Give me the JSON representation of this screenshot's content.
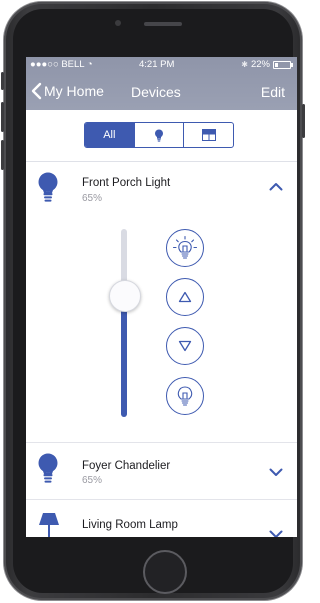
{
  "status_bar": {
    "carrier": "●●●○○ BELL ◔",
    "time": "4:21 PM",
    "bluetooth": "✱",
    "battery_percent": "22%",
    "battery_level": 0.22
  },
  "nav": {
    "back_label": "My Home",
    "title": "Devices",
    "edit_label": "Edit"
  },
  "filter": {
    "options": [
      {
        "label": "All",
        "icon": "",
        "selected": true
      },
      {
        "label": "",
        "icon": "bulb-icon",
        "selected": false
      },
      {
        "label": "",
        "icon": "window-blind-icon",
        "selected": false
      }
    ]
  },
  "devices": [
    {
      "name": "Front Porch Light",
      "level": "65%",
      "level_value": 0.65,
      "expanded": true,
      "icon": "bulb-icon"
    },
    {
      "name": "Foyer Chandelier",
      "level": "65%",
      "level_value": 0.65,
      "expanded": false,
      "icon": "bulb-icon"
    },
    {
      "name": "Living Room Lamp",
      "level": "",
      "expanded": false,
      "icon": "lamp-icon"
    }
  ],
  "controls": [
    {
      "icon": "light-on-icon"
    },
    {
      "icon": "raise-icon"
    },
    {
      "icon": "lower-icon"
    },
    {
      "icon": "light-off-icon"
    }
  ],
  "colors": {
    "accent": "#3e5ab0",
    "navbar": "#959bae",
    "divider": "#e3e4ea"
  }
}
